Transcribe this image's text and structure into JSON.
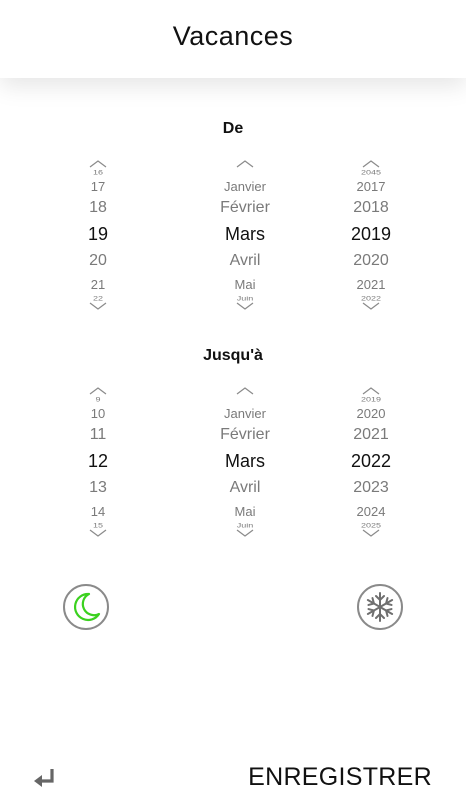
{
  "header": {
    "title": "Vacances"
  },
  "from": {
    "label": "De",
    "day": {
      "edge_top": "16",
      "r1": "17",
      "r2": "18",
      "selected": "19",
      "r3": "20",
      "r4": "21",
      "edge_bot": "22"
    },
    "month": {
      "edge_top": "",
      "r1": "Janvier",
      "r2": "Février",
      "selected": "Mars",
      "r3": "Avril",
      "r4": "Mai",
      "edge_bot": "Juin"
    },
    "year": {
      "edge_top": "2045",
      "r1": "2017",
      "r2": "2018",
      "selected": "2019",
      "r3": "2020",
      "r4": "2021",
      "edge_bot": "2022"
    }
  },
  "to": {
    "label": "Jusqu'à",
    "day": {
      "edge_top": "9",
      "r1": "10",
      "r2": "11",
      "selected": "12",
      "r3": "13",
      "r4": "14",
      "edge_bot": "15"
    },
    "month": {
      "edge_top": "",
      "r1": "Janvier",
      "r2": "Février",
      "selected": "Mars",
      "r3": "Avril",
      "r4": "Mai",
      "edge_bot": "Juin"
    },
    "year": {
      "edge_top": "2019",
      "r1": "2020",
      "r2": "2021",
      "selected": "2022",
      "r3": "2023",
      "r4": "2024",
      "edge_bot": "2025"
    }
  },
  "icons": {
    "night": "moon-icon",
    "winter": "snowflake-icon",
    "back": "return-arrow-icon"
  },
  "colors": {
    "moon": "#3bd11f",
    "icon_ring": "#8a8a8a",
    "snowflake": "#6f6f6f",
    "muted_text": "#7a7a7a"
  },
  "footer": {
    "save_label": "ENREGISTRER"
  }
}
